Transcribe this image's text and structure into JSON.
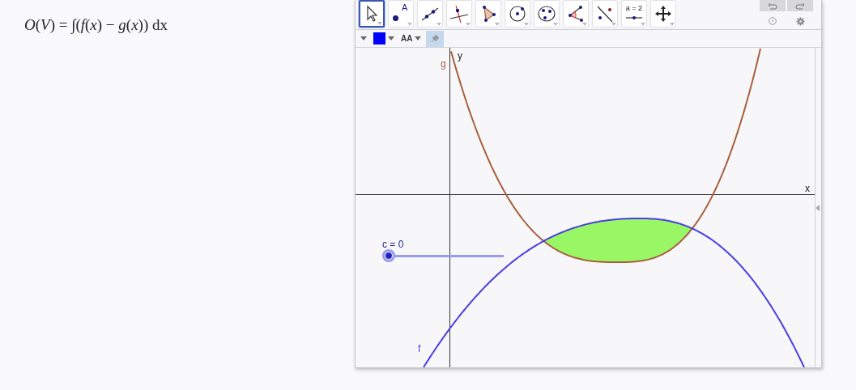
{
  "formula": "*O*(*V*) = ∫(*f*(*x*) − *g*(*x*)) dx",
  "toolbar": {
    "tools": [
      {
        "kind": "move",
        "selected": true
      },
      {
        "kind": "point",
        "label": "A",
        "selected": false
      },
      {
        "kind": "line",
        "selected": false
      },
      {
        "kind": "perpendicular",
        "selected": false
      },
      {
        "kind": "polygon",
        "selected": false
      },
      {
        "kind": "circle",
        "selected": false
      },
      {
        "kind": "conic",
        "selected": false
      },
      {
        "kind": "angle",
        "selected": false
      },
      {
        "kind": "reflect",
        "selected": false
      },
      {
        "kind": "slider",
        "label": "a = 2",
        "selected": false
      },
      {
        "kind": "move_view",
        "selected": false
      }
    ]
  },
  "style_bar": {
    "color": "#0000ff",
    "text_size": "AA",
    "pinned": true
  },
  "graph": {
    "x_axis_label": "x",
    "y_axis_label": "y",
    "functions": [
      {
        "name": "g",
        "kind": "opens_up",
        "color": "#a8603c"
      },
      {
        "name": "f",
        "kind": "opens_down",
        "color": "#4a3fe0"
      }
    ],
    "slider": {
      "label": "c = 0",
      "level": 0
    }
  }
}
